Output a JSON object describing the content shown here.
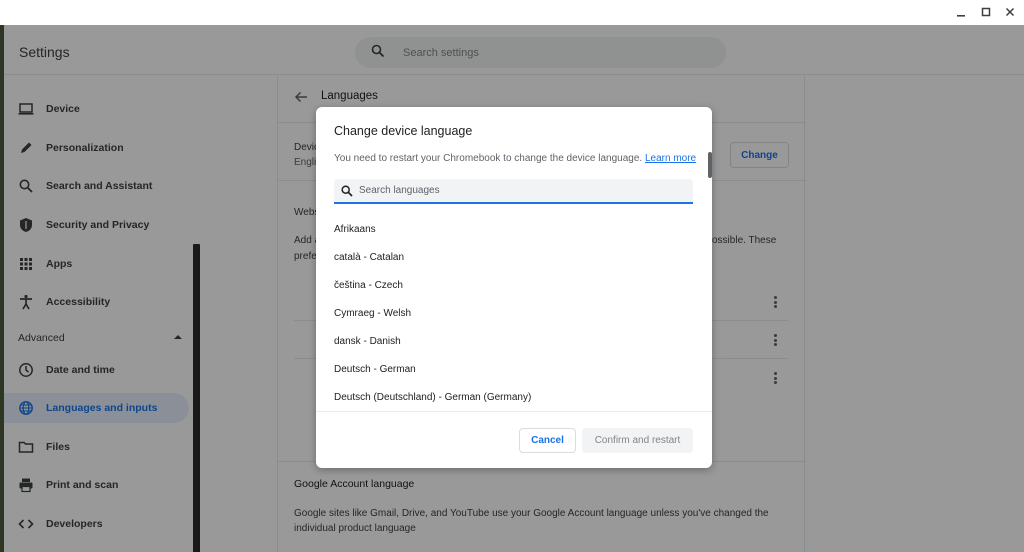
{
  "window": {
    "minimize_glyph": "—",
    "maximize_glyph": "☐",
    "close_glyph": "✕"
  },
  "header": {
    "title": "Settings",
    "search_placeholder": "Search settings"
  },
  "sidebar": {
    "items": [
      {
        "label": "Device",
        "icon": "laptop-icon"
      },
      {
        "label": "Personalization",
        "icon": "pencil-icon"
      },
      {
        "label": "Search and Assistant",
        "icon": "search-icon"
      },
      {
        "label": "Security and Privacy",
        "icon": "shield-icon"
      },
      {
        "label": "Apps",
        "icon": "apps-grid-icon"
      },
      {
        "label": "Accessibility",
        "icon": "accessibility-icon"
      }
    ],
    "advanced_label": "Advanced",
    "advanced_items": [
      {
        "label": "Date and time",
        "icon": "clock-icon"
      },
      {
        "label": "Languages and inputs",
        "icon": "globe-icon",
        "active": true
      },
      {
        "label": "Files",
        "icon": "folder-icon"
      },
      {
        "label": "Print and scan",
        "icon": "printer-icon"
      },
      {
        "label": "Developers",
        "icon": "code-icon"
      }
    ]
  },
  "main": {
    "page_title": "Languages",
    "device_language_label": "Devic",
    "device_language_value": "Engli",
    "change_button_label": "Change",
    "website_lang_label": "Webs",
    "website_lang_desc_1": "Add a",
    "website_lang_desc_2": "prefe",
    "website_lang_desc_right": "ossible. These",
    "google_account_title": "Google Account language",
    "google_account_desc": "Google sites like Gmail, Drive, and YouTube use your Google Account language unless you've changed the individual product language"
  },
  "dialog": {
    "title": "Change device language",
    "description": "You need to restart your Chromebook to change the device language.",
    "learn_more": "Learn more",
    "search_placeholder": "Search languages",
    "languages": [
      "Afrikaans",
      "català - Catalan",
      "čeština - Czech",
      "Cymraeg - Welsh",
      "dansk - Danish",
      "Deutsch - German",
      "Deutsch (Deutschland) - German (Germany)"
    ],
    "cancel_label": "Cancel",
    "confirm_label": "Confirm and restart"
  },
  "colors": {
    "accent": "#1a73e8",
    "overlay": "rgba(0,0,0,0.4)"
  }
}
